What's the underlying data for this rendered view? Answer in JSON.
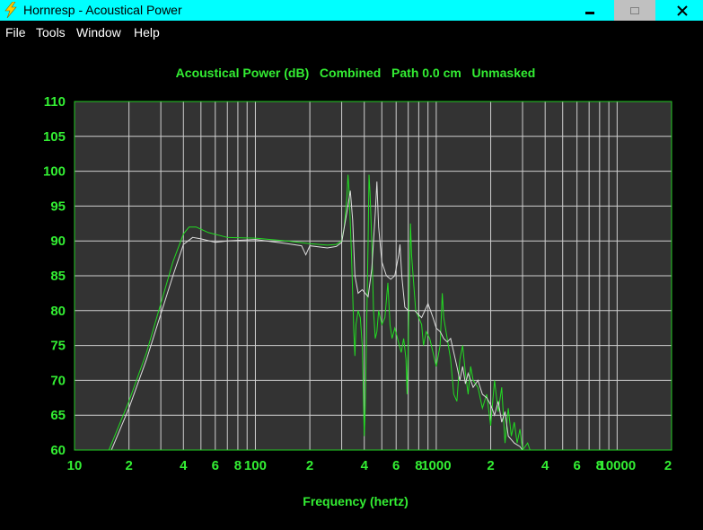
{
  "window": {
    "title": "Hornresp - Acoustical Power",
    "menu": [
      "File",
      "Tools",
      "Window",
      "Help"
    ]
  },
  "colors": {
    "titlebar": "#00ffff",
    "plot_bg": "#333333",
    "grid": "#cfcfcf",
    "text_green": "#33ee33",
    "series_green": "#22dd22",
    "series_white": "#dddddd"
  },
  "chart_data": {
    "type": "line",
    "title": "Acoustical Power (dB)   Combined   Path 0.0 cm   Unmasked",
    "xlabel": "Frequency (hertz)",
    "ylabel": "",
    "x_scale": "log",
    "xlim": [
      10,
      20000
    ],
    "ylim": [
      60,
      110
    ],
    "grid": true,
    "y_ticks": [
      110,
      105,
      100,
      95,
      90,
      85,
      80,
      75,
      70,
      65,
      60
    ],
    "x_tick_labels": [
      {
        "x": 10,
        "label": "10"
      },
      {
        "x": 20,
        "label": "2"
      },
      {
        "x": 40,
        "label": "4"
      },
      {
        "x": 60,
        "label": "6"
      },
      {
        "x": 80,
        "label": "8"
      },
      {
        "x": 100,
        "label": "100"
      },
      {
        "x": 200,
        "label": "2"
      },
      {
        "x": 400,
        "label": "4"
      },
      {
        "x": 600,
        "label": "6"
      },
      {
        "x": 800,
        "label": "8"
      },
      {
        "x": 1000,
        "label": "1000"
      },
      {
        "x": 2000,
        "label": "2"
      },
      {
        "x": 4000,
        "label": "4"
      },
      {
        "x": 6000,
        "label": "6"
      },
      {
        "x": 8000,
        "label": "8"
      },
      {
        "x": 10000,
        "label": "10000"
      },
      {
        "x": 20000,
        "label": "2"
      }
    ],
    "series": [
      {
        "color": "#22dd22",
        "points": [
          [
            15.5,
            60
          ],
          [
            20,
            67
          ],
          [
            25,
            74
          ],
          [
            30,
            81
          ],
          [
            35,
            87
          ],
          [
            40,
            91
          ],
          [
            43,
            92
          ],
          [
            47,
            92
          ],
          [
            55,
            91.2
          ],
          [
            70,
            90.5
          ],
          [
            100,
            90.4
          ],
          [
            150,
            90
          ],
          [
            200,
            89.6
          ],
          [
            250,
            89.4
          ],
          [
            280,
            89.5
          ],
          [
            300,
            90
          ],
          [
            310,
            92
          ],
          [
            320,
            96
          ],
          [
            325,
            99.5
          ],
          [
            330,
            97
          ],
          [
            340,
            88
          ],
          [
            350,
            77
          ],
          [
            355,
            73.5
          ],
          [
            360,
            78
          ],
          [
            370,
            80
          ],
          [
            380,
            79
          ],
          [
            390,
            75
          ],
          [
            395,
            69
          ],
          [
            400,
            62
          ],
          [
            405,
            66
          ],
          [
            410,
            74
          ],
          [
            420,
            90
          ],
          [
            425,
            99.5
          ],
          [
            430,
            97
          ],
          [
            440,
            90
          ],
          [
            450,
            80
          ],
          [
            460,
            76
          ],
          [
            470,
            77
          ],
          [
            480,
            80
          ],
          [
            500,
            78
          ],
          [
            520,
            79
          ],
          [
            540,
            84
          ],
          [
            555,
            78
          ],
          [
            570,
            76
          ],
          [
            590,
            77.5
          ],
          [
            610,
            76
          ],
          [
            640,
            74
          ],
          [
            660,
            76
          ],
          [
            680,
            73
          ],
          [
            690,
            68
          ],
          [
            700,
            75
          ],
          [
            720,
            92.5
          ],
          [
            730,
            88
          ],
          [
            750,
            84
          ],
          [
            770,
            80
          ],
          [
            800,
            79
          ],
          [
            830,
            78
          ],
          [
            850,
            75
          ],
          [
            880,
            77
          ],
          [
            920,
            76
          ],
          [
            960,
            74
          ],
          [
            1000,
            72
          ],
          [
            1050,
            75
          ],
          [
            1080,
            82.5
          ],
          [
            1100,
            79
          ],
          [
            1150,
            76
          ],
          [
            1200,
            73
          ],
          [
            1250,
            68
          ],
          [
            1300,
            67
          ],
          [
            1350,
            73
          ],
          [
            1400,
            75
          ],
          [
            1450,
            71
          ],
          [
            1500,
            68
          ],
          [
            1550,
            72
          ],
          [
            1600,
            70
          ],
          [
            1700,
            69
          ],
          [
            1800,
            66
          ],
          [
            1900,
            68
          ],
          [
            2000,
            63.5
          ],
          [
            2100,
            70
          ],
          [
            2200,
            65.5
          ],
          [
            2300,
            69
          ],
          [
            2400,
            61
          ],
          [
            2500,
            66
          ],
          [
            2600,
            62
          ],
          [
            2700,
            64
          ],
          [
            2800,
            61
          ],
          [
            2900,
            63
          ],
          [
            3000,
            60
          ],
          [
            3200,
            61
          ],
          [
            3400,
            59
          ]
        ]
      },
      {
        "color": "#dddddd",
        "points": [
          [
            16,
            60
          ],
          [
            20,
            66
          ],
          [
            25,
            73
          ],
          [
            30,
            79.5
          ],
          [
            35,
            85
          ],
          [
            40,
            89.5
          ],
          [
            45,
            90.5
          ],
          [
            50,
            90.3
          ],
          [
            60,
            89.8
          ],
          [
            70,
            90
          ],
          [
            100,
            90.2
          ],
          [
            150,
            89.6
          ],
          [
            180,
            89.3
          ],
          [
            190,
            88
          ],
          [
            200,
            89.3
          ],
          [
            250,
            89
          ],
          [
            280,
            89.2
          ],
          [
            300,
            89.8
          ],
          [
            320,
            94
          ],
          [
            335,
            97.2
          ],
          [
            345,
            93
          ],
          [
            355,
            85
          ],
          [
            370,
            82.5
          ],
          [
            390,
            83
          ],
          [
            420,
            82
          ],
          [
            440,
            86
          ],
          [
            460,
            94
          ],
          [
            470,
            98.5
          ],
          [
            480,
            92
          ],
          [
            500,
            87
          ],
          [
            530,
            85
          ],
          [
            560,
            84.5
          ],
          [
            590,
            85
          ],
          [
            620,
            88
          ],
          [
            630,
            89.5
          ],
          [
            645,
            85
          ],
          [
            670,
            80.5
          ],
          [
            700,
            80
          ],
          [
            760,
            80
          ],
          [
            830,
            79
          ],
          [
            900,
            81
          ],
          [
            960,
            79
          ],
          [
            1000,
            77.5
          ],
          [
            1050,
            77
          ],
          [
            1100,
            76
          ],
          [
            1150,
            75.5
          ],
          [
            1200,
            76
          ],
          [
            1250,
            74
          ],
          [
            1300,
            72
          ],
          [
            1350,
            70
          ],
          [
            1400,
            72
          ],
          [
            1450,
            69.5
          ],
          [
            1500,
            71
          ],
          [
            1600,
            69
          ],
          [
            1700,
            70
          ],
          [
            1800,
            68
          ],
          [
            1900,
            67.5
          ],
          [
            2000,
            66.5
          ],
          [
            2100,
            65
          ],
          [
            2200,
            67
          ],
          [
            2300,
            64
          ],
          [
            2400,
            65.5
          ],
          [
            2500,
            62
          ],
          [
            2700,
            61
          ],
          [
            2900,
            60.5
          ],
          [
            3000,
            60
          ]
        ]
      }
    ]
  }
}
